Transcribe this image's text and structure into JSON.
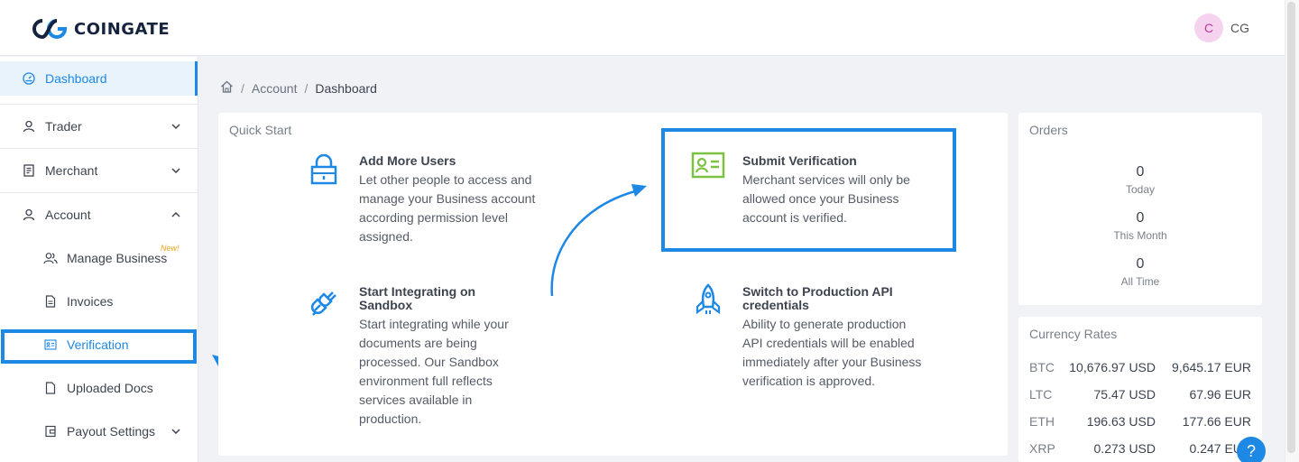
{
  "brand": {
    "name": "COINGATE"
  },
  "user": {
    "initial": "C",
    "name": "CG"
  },
  "sidebar": {
    "items": [
      {
        "label": "Dashboard",
        "icon": "dashboard-icon"
      },
      {
        "label": "Trader",
        "icon": "user-icon"
      },
      {
        "label": "Merchant",
        "icon": "receipt-icon"
      },
      {
        "label": "Account",
        "icon": "user-icon"
      },
      {
        "label": "Manage Business",
        "icon": "users-icon",
        "badge": "New!"
      },
      {
        "label": "Invoices",
        "icon": "file-icon"
      },
      {
        "label": "Verification",
        "icon": "id-card-icon"
      },
      {
        "label": "Uploaded Docs",
        "icon": "file-icon"
      },
      {
        "label": "Payout Settings",
        "icon": "wallet-icon"
      }
    ]
  },
  "breadcrumb": {
    "items": [
      "Account",
      "Dashboard"
    ]
  },
  "quick_start": {
    "title": "Quick Start",
    "items": [
      {
        "title": "Add More Users",
        "text": "Let other people to access and manage your Business account according permission level assigned."
      },
      {
        "title": "Submit Verification",
        "text": "Merchant services will only be allowed once your Business account is verified."
      },
      {
        "title": "Start Integrating on Sandbox",
        "text": "Start integrating while your documents are being processed. Our Sandbox environment full reflects services available in production."
      },
      {
        "title": "Switch to Production API credentials",
        "text": "Ability to generate production API credentials will be enabled immediately after your Business verification is approved."
      }
    ]
  },
  "orders": {
    "title": "Orders",
    "stats": [
      {
        "value": "0",
        "label": "Today"
      },
      {
        "value": "0",
        "label": "This Month"
      },
      {
        "value": "0",
        "label": "All Time"
      }
    ]
  },
  "rates": {
    "title": "Currency Rates",
    "rows": [
      {
        "sym": "BTC",
        "usd": "10,676.97 USD",
        "eur": "9,645.17 EUR"
      },
      {
        "sym": "LTC",
        "usd": "75.47 USD",
        "eur": "67.96 EUR"
      },
      {
        "sym": "ETH",
        "usd": "196.63 USD",
        "eur": "177.66 EUR"
      },
      {
        "sym": "XRP",
        "usd": "0.273 USD",
        "eur": "0.247 EUR"
      }
    ]
  },
  "help": {
    "label": "?"
  },
  "colors": {
    "accent": "#1e88e5",
    "verify_green": "#7cc242"
  }
}
